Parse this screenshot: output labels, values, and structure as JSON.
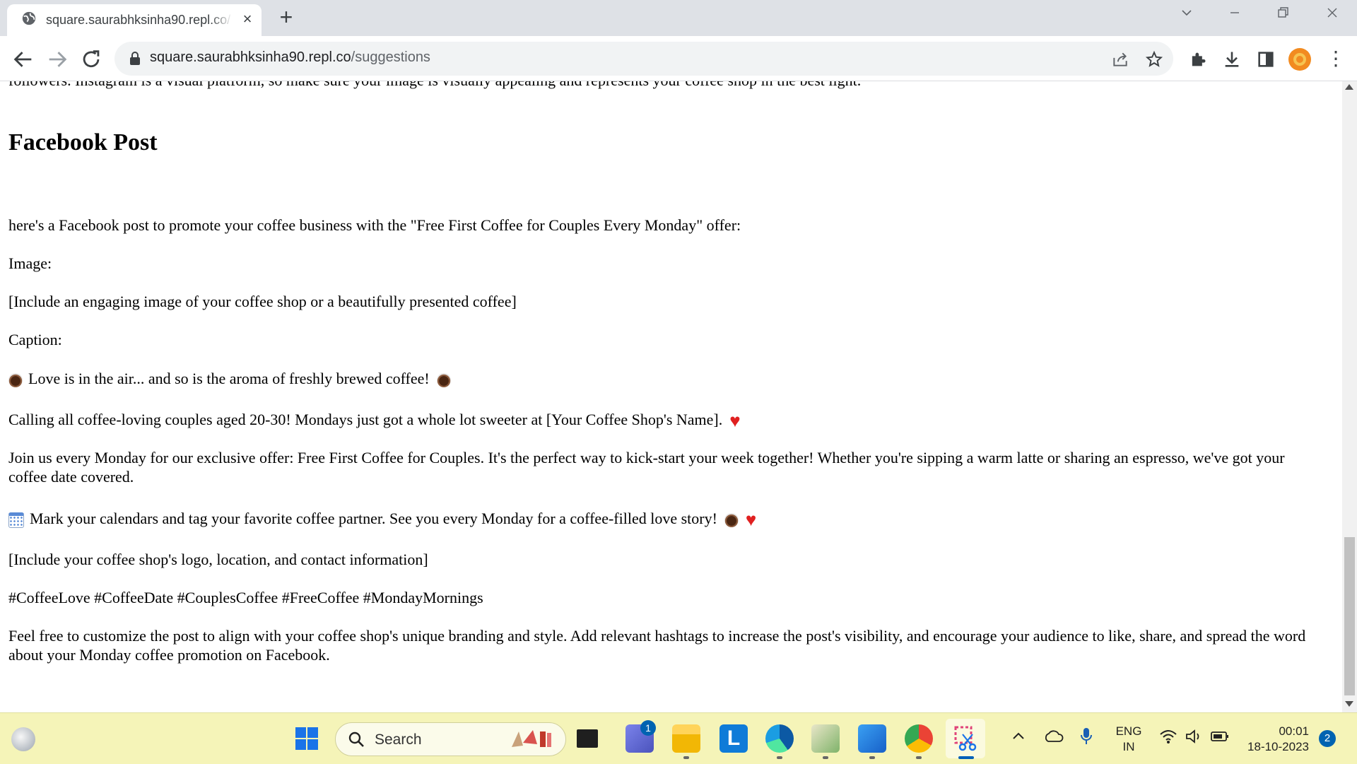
{
  "browser": {
    "tab_title": "square.saurabhksinha90.repl.co/",
    "url_host": "square.saurabhksinha90.repl.co",
    "url_path": "/suggestions"
  },
  "page": {
    "clipped_line": "followers. Instagram is a visual platform, so make sure your image is visually appealing and represents your coffee shop in the best light.",
    "heading": "Facebook Post",
    "intro": "here's a Facebook post to promote your coffee business with the \"Free First Coffee for Couples Every Monday\" offer:",
    "image_label": "Image:",
    "image_note": "[Include an engaging image of your coffee shop or a beautifully presented coffee]",
    "caption_label": "Caption:",
    "caption_line": "Love is in the air... and so is the aroma of freshly brewed coffee!",
    "calling_line": "Calling all coffee-loving couples aged 20-30! Mondays just got a whole lot sweeter at [Your Coffee Shop's Name].",
    "join_line": "Join us every Monday for our exclusive offer: Free First Coffee for Couples. It's the perfect way to kick-start your week together! Whether you're sipping a warm latte or sharing an espresso, we've got your coffee date covered.",
    "mark_line": "Mark your calendars and tag your favorite coffee partner. See you every Monday for a coffee-filled love story!",
    "logo_note": "[Include your coffee shop's logo, location, and contact information]",
    "hashtags": "#CoffeeLove #CoffeeDate #CouplesCoffee #FreeCoffee #MondayMornings",
    "closing": "Feel free to customize the post to align with your coffee shop's unique branding and style. Add relevant hashtags to increase the post's visibility, and encourage your audience to like, share, and spread the word about your Monday coffee promotion on Facebook."
  },
  "taskbar": {
    "search_label": "Search",
    "teams_badge": "1",
    "lang_line1": "ENG",
    "lang_line2": "IN",
    "time": "00:01",
    "date": "18-10-2023",
    "notification_count": "2"
  },
  "colors": {
    "tabbar_bg": "#dee1e6",
    "taskbar_bg": "#f5f4b8",
    "accent": "#0063b1",
    "heart": "#e02020"
  }
}
